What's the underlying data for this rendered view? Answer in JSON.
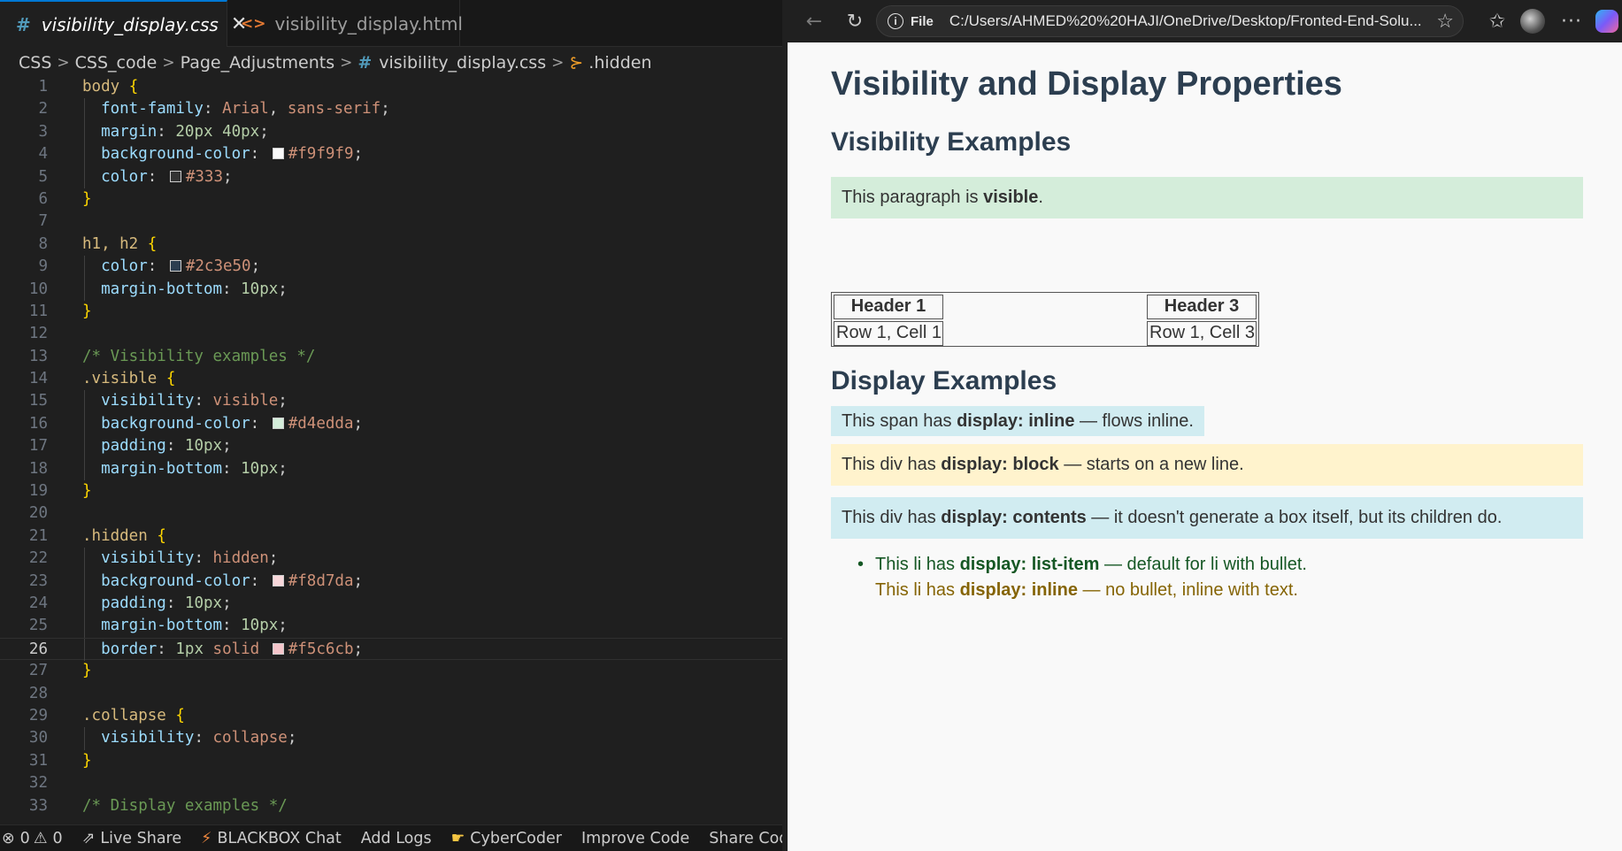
{
  "editor": {
    "tabs": [
      {
        "icon": "#",
        "label": "visibility_display.css",
        "close": "✕"
      },
      {
        "icon": "<>",
        "label": "visibility_display.html"
      }
    ],
    "breadcrumb": [
      "CSS",
      "CSS_code",
      "Page_Adjustments",
      "visibility_display.css",
      ".hidden"
    ],
    "active_line": 26,
    "colors": {
      "accent": "#0078d4",
      "background": "#1f1f1f"
    },
    "code_lines": [
      "body {",
      "  font-family: Arial, sans-serif;",
      "  margin: 20px 40px;",
      "  background-color: #f9f9f9;",
      "  color: #333;",
      "}",
      "",
      "h1, h2 {",
      "  color: #2c3e50;",
      "  margin-bottom: 10px;",
      "}",
      "",
      "/* Visibility examples */",
      ".visible {",
      "  visibility: visible;",
      "  background-color: #d4edda;",
      "  padding: 10px;",
      "  margin-bottom: 10px;",
      "}",
      "",
      ".hidden {",
      "  visibility: hidden;",
      "  background-color: #f8d7da;",
      "  padding: 10px;",
      "  margin-bottom: 10px;",
      "  border: 1px solid #f5c6cb;",
      "}",
      "",
      ".collapse {",
      "  visibility: collapse;",
      "}",
      "",
      "/* Display examples */"
    ]
  },
  "statusbar": {
    "errors": "0",
    "warnings": "0",
    "live_share": "Live Share",
    "blackbox": "BLACKBOX Chat",
    "add_logs": "Add Logs",
    "cybercoder": "CyberCoder",
    "improve": "Improve Code",
    "share": "Share Code Link"
  },
  "browser": {
    "address_label": "File",
    "url": "C:/Users/AHMED%20%20HAJI/OneDrive/Desktop/Fronted-End-Solu...",
    "page": {
      "h1": "Visibility and Display Properties",
      "h2_visibility": "Visibility Examples",
      "visible_para": {
        "pre": "This paragraph is ",
        "bold": "visible",
        "post": "."
      },
      "table": {
        "header1": "Header 1",
        "header3": "Header 3",
        "cell1": "Row 1, Cell 1",
        "cell3": "Row 1, Cell 3"
      },
      "h2_display": "Display Examples",
      "inline_span": {
        "pre": "This span has ",
        "bold": "display: inline",
        "post": " — flows inline."
      },
      "block_div": {
        "pre": "This div has ",
        "bold": "display: block",
        "post": " — starts on a new line."
      },
      "contents_div": {
        "pre": "This div has ",
        "bold": "display: contents",
        "post": " — it doesn't generate a box itself, but its children do."
      },
      "li_item": {
        "pre": "This li has ",
        "bold": "display: list-item",
        "post": " — default for li with bullet."
      },
      "li_inline": {
        "pre": "This li has ",
        "bold": "display: inline",
        "post": " — no bullet, inline with text."
      }
    },
    "colors": {
      "heading": "#2c3e50",
      "visible_bg": "#d4edda",
      "block_bg": "#fff3cd",
      "inline_bg": "#d1ecf1",
      "li_green": "#155724",
      "li_brown": "#856404"
    }
  }
}
